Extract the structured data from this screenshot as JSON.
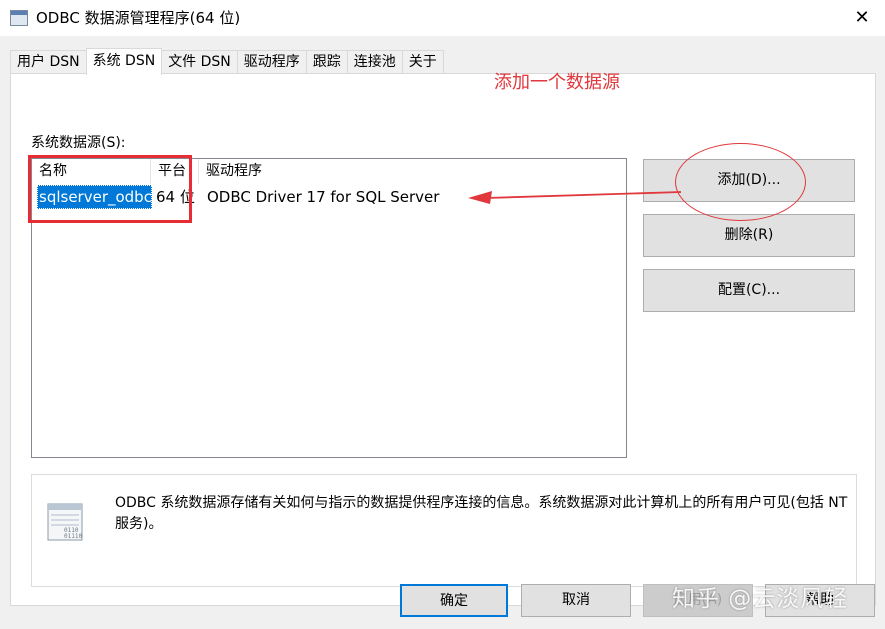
{
  "window": {
    "title": "ODBC 数据源管理程序(64 位)",
    "close_glyph": "✕"
  },
  "tabs": [
    {
      "label": "用户 DSN",
      "active": false
    },
    {
      "label": "系统 DSN",
      "active": true
    },
    {
      "label": "文件 DSN",
      "active": false
    },
    {
      "label": "驱动程序",
      "active": false
    },
    {
      "label": "跟踪",
      "active": false
    },
    {
      "label": "连接池",
      "active": false
    },
    {
      "label": "关于",
      "active": false
    }
  ],
  "annotation": {
    "text": "添加一个数据源",
    "color": "#e0383c"
  },
  "system_dsn": {
    "section_label": "系统数据源(S):",
    "columns": [
      "名称",
      "平台",
      "驱动程序"
    ],
    "rows": [
      {
        "name": "sqlserver_odbc",
        "platform": "64 位",
        "driver": "ODBC Driver 17 for SQL Server",
        "selected": true
      }
    ],
    "buttons": {
      "add": "添加(D)...",
      "remove": "删除(R)",
      "configure": "配置(C)..."
    },
    "info_text": "ODBC 系统数据源存储有关如何与指示的数据提供程序连接的信息。系统数据源对此计算机上的所有用户可见(包括 NT 服务)。"
  },
  "footer": {
    "ok": "确定",
    "cancel": "取消",
    "apply": "应用(A)",
    "help": "帮助"
  },
  "watermark": "知乎 @云淡风轻",
  "colors": {
    "selection": "#0078d7",
    "annotation_red": "#e0383c",
    "dialog_bg": "#f0f0f0"
  }
}
